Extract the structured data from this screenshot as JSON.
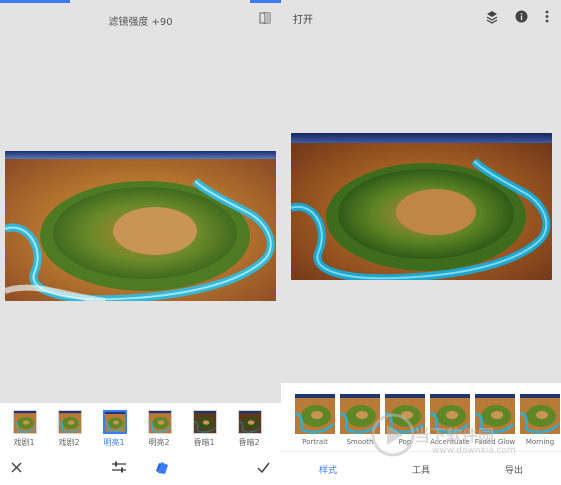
{
  "left": {
    "title": "滤镜强度 +90",
    "filters": [
      {
        "label": "戏剧1",
        "selected": false
      },
      {
        "label": "戏剧2",
        "selected": false
      },
      {
        "label": "明亮1",
        "selected": true
      },
      {
        "label": "明亮2",
        "selected": false
      },
      {
        "label": "昏暗1",
        "selected": false
      },
      {
        "label": "昏暗2",
        "selected": false
      }
    ],
    "icons": [
      "close-icon",
      "sliders-icon",
      "style-brush-icon",
      "check-icon"
    ]
  },
  "right": {
    "open_label": "打开",
    "top_icons": [
      "layers-icon",
      "info-icon",
      "more-vert-icon"
    ],
    "styles": [
      "Portrait",
      "Smooth",
      "Pop",
      "Accentuate",
      "Faded Glow",
      "Morning"
    ],
    "nav": [
      {
        "label": "样式",
        "selected": true
      },
      {
        "label": "工具",
        "selected": false
      },
      {
        "label": "导出",
        "selected": false
      }
    ]
  },
  "watermark": {
    "site": "当下软件园",
    "url": "www.downxia.com"
  },
  "colors": {
    "accent": "#3b7cff",
    "panel_bg": "#e3e3e3"
  }
}
